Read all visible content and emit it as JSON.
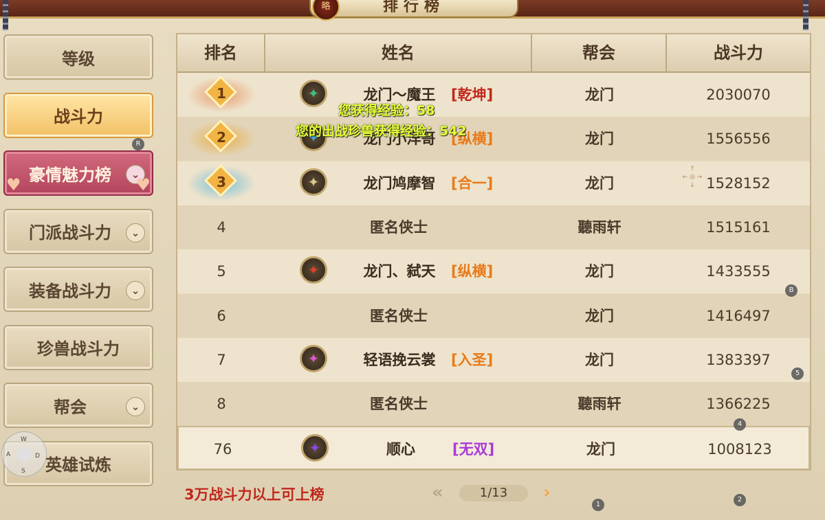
{
  "title": "排行榜",
  "title_medal": "略",
  "sidebar": {
    "items": [
      {
        "label": "等级",
        "state": "normal",
        "dropdown": false
      },
      {
        "label": "战斗力",
        "state": "active",
        "dropdown": false
      },
      {
        "label": "豪情魅力榜",
        "state": "pink",
        "dropdown": true
      },
      {
        "label": "门派战斗力",
        "state": "normal",
        "dropdown": true
      },
      {
        "label": "装备战斗力",
        "state": "normal",
        "dropdown": true
      },
      {
        "label": "珍兽战斗力",
        "state": "normal",
        "dropdown": false
      },
      {
        "label": "帮会",
        "state": "normal",
        "dropdown": true
      },
      {
        "label": "英雄试炼",
        "state": "normal",
        "dropdown": false
      }
    ]
  },
  "table": {
    "headers": [
      "排名",
      "姓名",
      "帮会",
      "战斗力"
    ],
    "rows": [
      {
        "rank": "1",
        "medal": true,
        "avatar": "jade",
        "name": "龙门～魔王",
        "sect": "[乾坤]",
        "sect_color": "#c0281c",
        "guild": "龙门",
        "power": "2030070"
      },
      {
        "rank": "2",
        "medal": true,
        "avatar": "blue",
        "name": "龙门小洋哥",
        "sect": "[纵横]",
        "sect_color": "#e87a1a",
        "guild": "龙门",
        "power": "1556556"
      },
      {
        "rank": "3",
        "medal": true,
        "avatar": "skull",
        "name": "龙门鸠摩智",
        "sect": "[合一]",
        "sect_color": "#e87a1a",
        "guild": "龙门",
        "power": "1528152"
      },
      {
        "rank": "4",
        "medal": false,
        "avatar": "",
        "name": "匿名侠士",
        "sect": "",
        "sect_color": "",
        "guild": "聽雨轩",
        "power": "1515161"
      },
      {
        "rank": "5",
        "medal": false,
        "avatar": "red",
        "name": "龙门、弑天",
        "sect": "[纵横]",
        "sect_color": "#e87a1a",
        "guild": "龙门",
        "power": "1433555"
      },
      {
        "rank": "6",
        "medal": false,
        "avatar": "",
        "name": "匿名侠士",
        "sect": "",
        "sect_color": "",
        "guild": "龙门",
        "power": "1416497"
      },
      {
        "rank": "7",
        "medal": false,
        "avatar": "pink",
        "name": "轻语挽云裳",
        "sect": "[入圣]",
        "sect_color": "#e87a1a",
        "guild": "龙门",
        "power": "1383397"
      },
      {
        "rank": "8",
        "medal": false,
        "avatar": "",
        "name": "匿名侠士",
        "sect": "",
        "sect_color": "",
        "guild": "聽雨轩",
        "power": "1366225"
      }
    ],
    "self_row": {
      "rank": "76",
      "avatar": "purple",
      "name": "顺心",
      "sect": "[无双]",
      "sect_color": "#a83ad8",
      "guild": "龙门",
      "power": "1008123"
    }
  },
  "exp_messages": [
    "您获得经验：58",
    "您的出战珍兽获得经验：542"
  ],
  "footer": {
    "note": "3万战斗力以上可上榜",
    "page": "1/13"
  },
  "joystick": {
    "up": "W",
    "left": "A",
    "right": "D",
    "down": "S"
  },
  "hint_badges": [
    "R",
    "B",
    "5",
    "4",
    "1",
    "2"
  ],
  "colors": {
    "accent": "#f2c065",
    "rank_gold": "#e8b04a",
    "exp_text": "#e8ff3a",
    "warning_text": "#c0281c"
  }
}
